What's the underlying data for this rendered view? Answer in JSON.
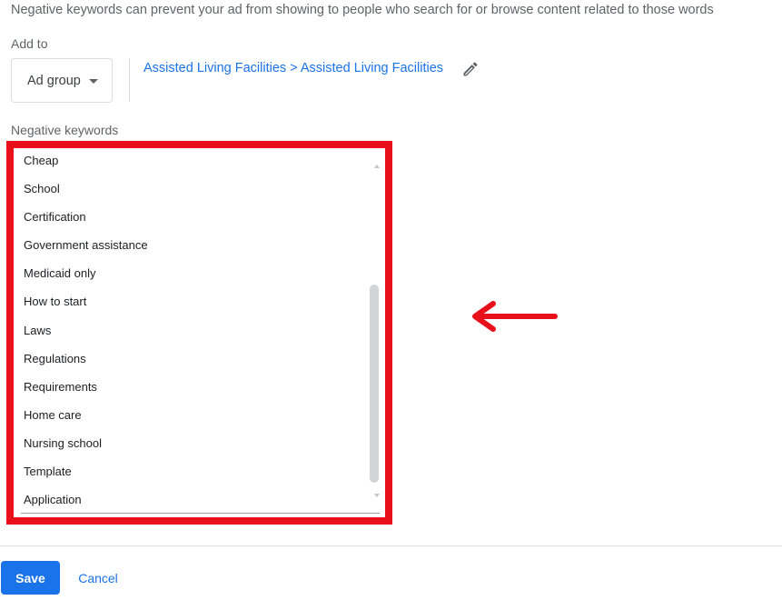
{
  "description": "Negative keywords can prevent your ad from showing to people who search for or browse content related to those words",
  "add_to": {
    "label": "Add to",
    "level_select": "Ad group",
    "path": "Assisted Living Facilities > Assisted Living Facilities"
  },
  "negative_keywords": {
    "label": "Negative keywords",
    "items": [
      "Cheap",
      "School",
      "Certification",
      "Government assistance",
      "Medicaid only",
      "How to start",
      "Laws",
      "Regulations",
      "Requirements",
      "Home care",
      "Nursing school",
      "Template",
      "Application"
    ]
  },
  "annotation": {
    "color": "#e8101a",
    "icon": "arrow-left-icon"
  },
  "actions": {
    "save_label": "Save",
    "cancel_label": "Cancel"
  },
  "colors": {
    "primary": "#1a73e8",
    "highlight": "#e8101a"
  }
}
